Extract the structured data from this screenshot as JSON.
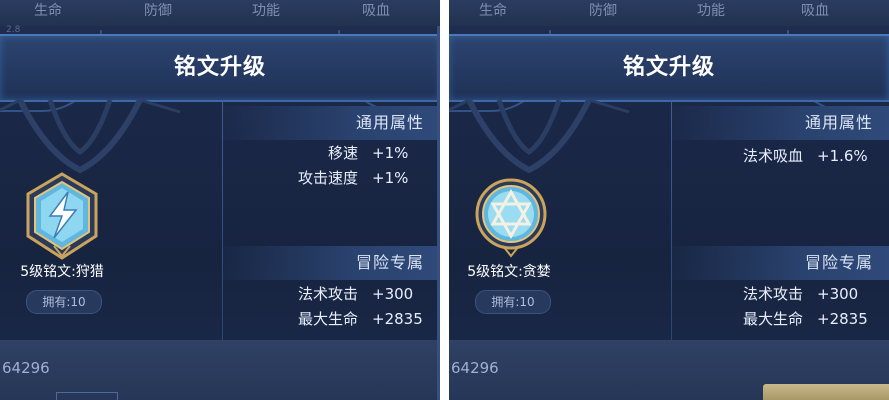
{
  "panels": [
    {
      "tabs": [
        "生命",
        "防御",
        "功能",
        "吸血"
      ],
      "faint_number": "2.8",
      "title": "铭文升级",
      "rune": {
        "name": "5级铭文:狩猎",
        "owned": "拥有:10",
        "icon": "lightning-rune-icon"
      },
      "general": {
        "title": "通用属性",
        "attrs": [
          {
            "name": "移速",
            "value": "+1%"
          },
          {
            "name": "攻击速度",
            "value": "+1%"
          }
        ]
      },
      "adventure": {
        "title": "冒险专属",
        "attrs": [
          {
            "name": "法术攻击",
            "value": "+300"
          },
          {
            "name": "最大生命",
            "value": "+2835"
          }
        ]
      },
      "bottom_number": "64296"
    },
    {
      "tabs": [
        "生命",
        "防御",
        "功能",
        "吸血"
      ],
      "faint_number": "",
      "title": "铭文升级",
      "rune": {
        "name": "5级铭文:贪婪",
        "owned": "拥有:10",
        "icon": "star-rune-icon"
      },
      "general": {
        "title": "通用属性",
        "attrs": [
          {
            "name": "法术吸血",
            "value": "+1.6%"
          }
        ]
      },
      "adventure": {
        "title": "冒险专属",
        "attrs": [
          {
            "name": "法术攻击",
            "value": "+300"
          },
          {
            "name": "最大生命",
            "value": "+2835"
          }
        ]
      },
      "bottom_number": "64296"
    }
  ],
  "colors": {
    "background": "#1a2747",
    "accent": "#3e68a6",
    "rune_blue": "#6fc8e8",
    "rune_gold": "#c9a45a"
  }
}
